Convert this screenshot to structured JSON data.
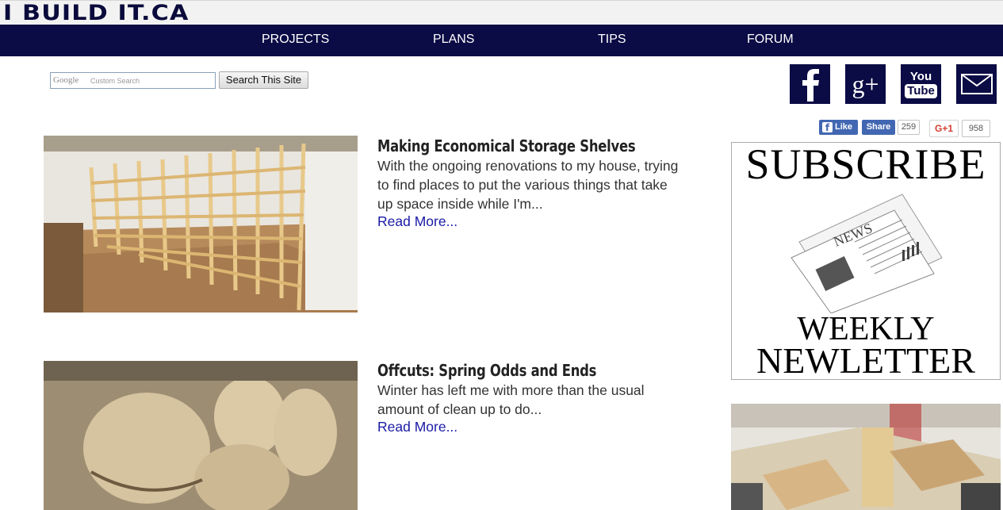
{
  "site": {
    "logo": "I BUILD IT.CA"
  },
  "nav": {
    "items": [
      "PROJECTS",
      "PLANS",
      "TIPS",
      "FORUM"
    ]
  },
  "search": {
    "brand": "Google",
    "placeholder": "Custom Search",
    "button_label": "Search This Site"
  },
  "social": {
    "icons": [
      "facebook-icon",
      "google-plus-icon",
      "youtube-icon",
      "email-icon"
    ],
    "youtube_top": "You",
    "youtube_bottom": "Tube",
    "gplus_label": "g+"
  },
  "share": {
    "fb_like": "Like",
    "fb_share": "Share",
    "share_count": "259",
    "gplus_label": "G+1",
    "gplus_count": "958"
  },
  "posts": [
    {
      "title": "Making Economical Storage Shelves",
      "excerpt": "With the ongoing renovations to my house, trying to find places to put the various things that take up space inside while I'm...",
      "read_more": "Read More..."
    },
    {
      "title": "Offcuts: Spring Odds and Ends",
      "excerpt": "Winter has left me with more than the usual amount of clean up to do...",
      "read_more": "Read More..."
    }
  ],
  "sidebar": {
    "subscribe_top": "SUBSCRIBE",
    "news_word": "NEWS",
    "subscribe_weekly": "WEEKLY",
    "subscribe_newsletter": "NEWLETTER"
  },
  "colors": {
    "nav_bg": "#0b0b45",
    "link": "#1a1aa6",
    "facebook": "#4267b2",
    "gplus": "#d23f31"
  }
}
